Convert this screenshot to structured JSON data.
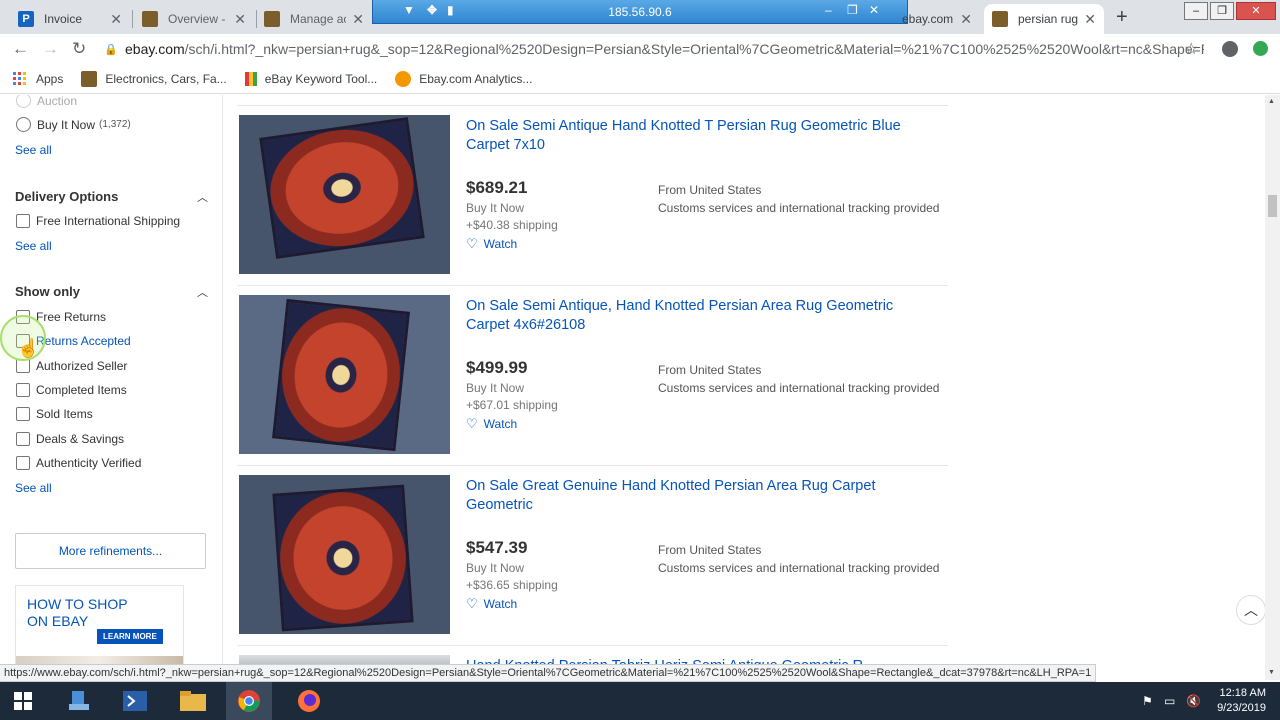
{
  "browser": {
    "tabs": [
      {
        "label": "Invoice",
        "color": "#1565c0",
        "active": false
      },
      {
        "label": "Overview - e",
        "color": "#7b5e2a",
        "active": false
      },
      {
        "label": "Manage acti",
        "color": "#7b5e2a",
        "active": false
      },
      {
        "label": "ebay.com A",
        "color": "#7b5e2a",
        "active": false
      },
      {
        "label": "persian rug",
        "color": "#7b5e2a",
        "active": true
      }
    ],
    "remote_ip": "185.56.90.6",
    "url_host": "ebay.com",
    "url_path": "/sch/i.html?_nkw=persian+rug&_sop=12&Regional%2520Design=Persian&Style=Oriental%7CGeometric&Material=%21%7C100%2525%2520Wool&rt=nc&Shape=Rec...",
    "bookmarks": [
      {
        "label": "Apps",
        "icon": "apps-grid-icon"
      },
      {
        "label": "Electronics, Cars, Fa...",
        "icon": "ebay-bag-icon"
      },
      {
        "label": "eBay Keyword Tool...",
        "icon": "bar-chart-icon"
      },
      {
        "label": "Ebay.com Analytics...",
        "icon": "analytics-icon"
      }
    ]
  },
  "sidebar": {
    "auction_label": "Auction",
    "buy_it_now": {
      "label": "Buy It Now",
      "count": "(1,372)"
    },
    "see_all": "See all",
    "delivery": {
      "heading": "Delivery Options",
      "options": [
        "Free International Shipping"
      ]
    },
    "show_only": {
      "heading": "Show only",
      "options": [
        "Free Returns",
        "Returns Accepted",
        "Authorized Seller",
        "Completed Items",
        "Sold Items",
        "Deals & Savings",
        "Authenticity Verified"
      ]
    },
    "more_refinements": "More refinements...",
    "promo": {
      "line1": "HOW TO SHOP",
      "line2": "ON EBAY",
      "cta": "LEARN MORE"
    }
  },
  "listings": [
    {
      "title": "On Sale Semi Antique Hand Knotted T Persian Rug Geometric Blue Carpet 7x10",
      "price": "$689.21",
      "format": "Buy It Now",
      "shipping": "+$40.38 shipping",
      "watch": "Watch",
      "from": "From United States",
      "customs": "Customs services and international tracking provided"
    },
    {
      "title": "On Sale Semi Antique, Hand Knotted Persian Area Rug Geometric Carpet 4x6#26108",
      "price": "$499.99",
      "format": "Buy It Now",
      "shipping": "+$67.01 shipping",
      "watch": "Watch",
      "from": "From United States",
      "customs": "Customs services and international tracking provided"
    },
    {
      "title": "On Sale Great Genuine Hand Knotted Persian Area Rug Carpet Geometric",
      "price": "$547.39",
      "format": "Buy It Now",
      "shipping": "+$36.65 shipping",
      "watch": "Watch",
      "from": "From United States",
      "customs": "Customs services and international tracking provided"
    }
  ],
  "partial_listing_title": "Hand Knotted Persian Tabriz Heriz Semi Antique Geometric R...",
  "status_url": "https://www.ebay.com/sch/i.html?_nkw=persian+rug&_sop=12&Regional%2520Design=Persian&Style=Oriental%7CGeometric&Material=%21%7C100%2525%2520Wool&Shape=Rectangle&_dcat=37978&rt=nc&LH_RPA=1",
  "taskbar": {
    "time": "12:18 AM",
    "date": "9/23/2019"
  },
  "colors": {
    "link": "#0654ba",
    "price": "#333333",
    "taskbar": "#1c2a3a"
  }
}
